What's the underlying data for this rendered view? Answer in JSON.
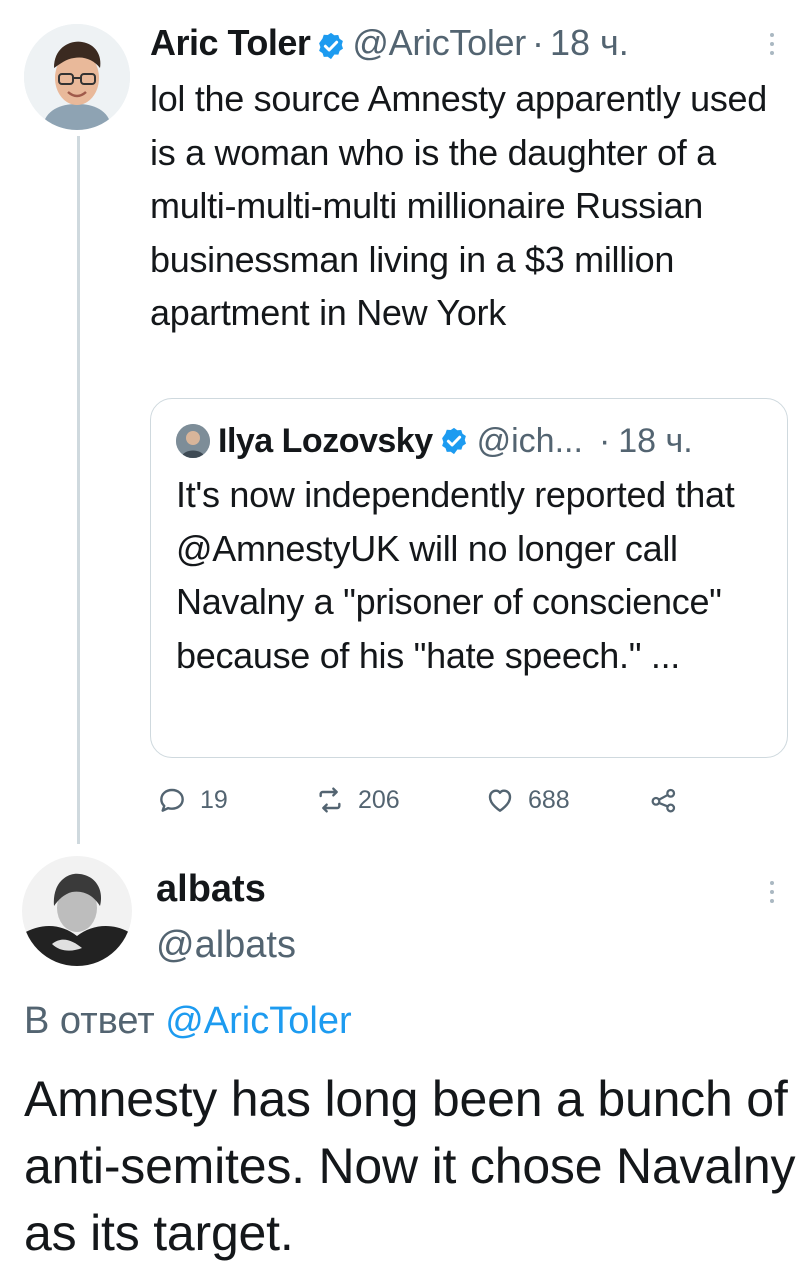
{
  "tweet1": {
    "author_name": "Aric Toler",
    "handle": "@AricToler",
    "time_separator": "·",
    "time": "18 ч.",
    "text": "lol the source Amnesty apparently used is a woman who is the daughter of a multi-multi-multi millionaire Russian businessman living in a $3 million apartment in New York",
    "quoted": {
      "author_name": "Ilya Lozovsky",
      "handle": "@ich...",
      "time_separator": "·",
      "time": "18 ч.",
      "text": "It's now independently reported that @AmnestyUK will no longer call Navalny a \"prisoner of conscience\" because of his \"hate speech.\" ..."
    },
    "actions": {
      "replies": "19",
      "retweets": "206",
      "likes": "688"
    }
  },
  "tweet2": {
    "author_name": "albats",
    "handle": "@albats",
    "reply_prefix": "В ответ",
    "reply_mention": "@AricToler",
    "text": "Amnesty has long been a bunch of anti-semites. Now it chose Navalny as its target."
  },
  "icons": {
    "verified": "verified-badge-icon",
    "more": "more-kebab-icon",
    "reply": "reply-icon",
    "retweet": "retweet-icon",
    "like": "heart-icon",
    "share": "share-icon"
  },
  "colors": {
    "accent": "#1d9bf0",
    "secondary_text": "#536471",
    "border": "#cfd9de"
  }
}
